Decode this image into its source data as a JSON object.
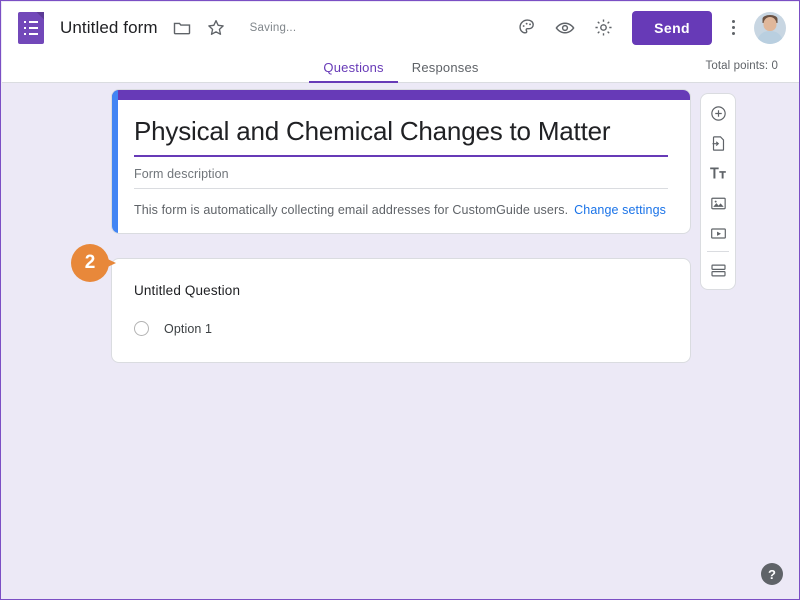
{
  "header": {
    "app_icon": "google-forms-icon",
    "doc_title": "Untitled form",
    "folder_icon": "folder-icon",
    "star_icon": "star-icon",
    "save_status": "Saving...",
    "theme_icon": "palette-icon",
    "preview_icon": "eye-icon",
    "settings_icon": "gear-icon",
    "send_label": "Send",
    "more_icon": "kebab-menu-icon",
    "avatar_icon": "user-avatar"
  },
  "tabs": {
    "items": [
      {
        "label": "Questions",
        "active": true
      },
      {
        "label": "Responses",
        "active": false
      }
    ],
    "total_points": "Total points: 0"
  },
  "form_header_card": {
    "title": "Physical and Chemical Changes to Matter",
    "description_placeholder": "Form description",
    "email_notice": "This form is automatically collecting email addresses for CustomGuide users.",
    "change_settings_link": "Change settings"
  },
  "question": {
    "title": "Untitled Question",
    "options": [
      {
        "label": "Option 1",
        "selected": false
      }
    ]
  },
  "side_toolbar": {
    "items": [
      {
        "icon": "add-question-icon",
        "tooltip": "Add question"
      },
      {
        "icon": "import-questions-icon",
        "tooltip": "Import questions"
      },
      {
        "icon": "add-title-description-icon",
        "tooltip": "Add title and description"
      },
      {
        "icon": "add-image-icon",
        "tooltip": "Add image"
      },
      {
        "icon": "add-video-icon",
        "tooltip": "Add video"
      },
      {
        "icon": "add-section-icon",
        "tooltip": "Add section"
      }
    ]
  },
  "callout": {
    "number": "2"
  },
  "help": {
    "label": "?"
  },
  "colors": {
    "brand_purple": "#673ab7",
    "page_background": "#ece9f6",
    "selection_blue": "#4285f4",
    "link_blue": "#1a73e8",
    "callout_orange": "#e8883a"
  }
}
